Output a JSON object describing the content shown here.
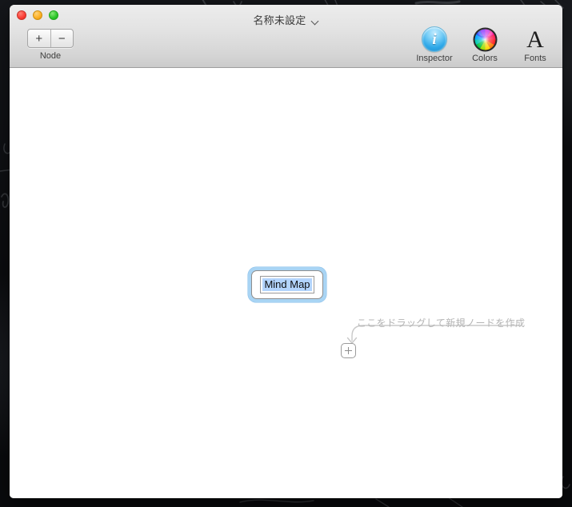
{
  "window": {
    "title": "名称未設定",
    "title_menu_icon": "chevron-down-icon",
    "traffic_lights": [
      {
        "name": "close",
        "label": "閉じる",
        "color": "#fb3e36"
      },
      {
        "name": "minimize",
        "label": "最小化",
        "color": "#fdb022"
      },
      {
        "name": "zoom",
        "label": "拡大/縮小",
        "color": "#2dc72a"
      }
    ]
  },
  "toolbar": {
    "node_group": {
      "label": "Node",
      "add_label": "+",
      "remove_label": "−"
    },
    "items": [
      {
        "icon": "inspector-icon",
        "glyph": "i",
        "label": "Inspector"
      },
      {
        "icon": "colors-icon",
        "glyph": "",
        "label": "Colors"
      },
      {
        "icon": "fonts-icon",
        "glyph": "A",
        "label": "Fonts"
      }
    ]
  },
  "canvas": {
    "background": "#ffffff",
    "node": {
      "text": "Mind Map",
      "selected": true,
      "editing": true,
      "selection_color": "#b3d4fc",
      "focus_ring_color": "#a8d4f4"
    },
    "drag_handle": {
      "icon": "plus-icon",
      "label": "+"
    },
    "hint": {
      "text": "ここをドラッグして新規ノードを作成",
      "color": "#b4b4b4"
    }
  }
}
